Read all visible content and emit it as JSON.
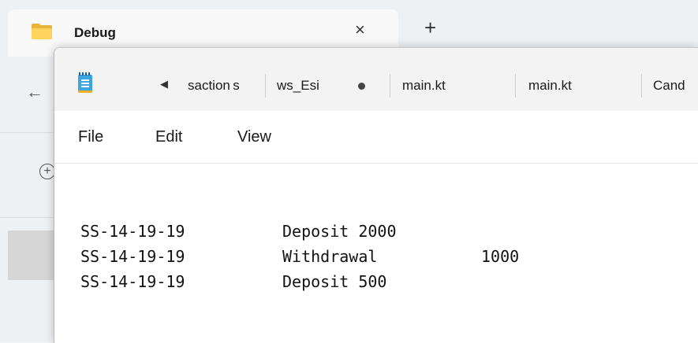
{
  "explorer": {
    "tab_title": "Debug",
    "tab_close": "×",
    "new_tab": "+",
    "nav_back": "←",
    "add": "+"
  },
  "notepad": {
    "scroll_left": "◀",
    "tabs": [
      {
        "label": "saction s"
      },
      {
        "label": "ws_Esi"
      },
      {
        "label": "main.kt"
      },
      {
        "label": "main.kt"
      },
      {
        "label": "Cand"
      }
    ],
    "menu": [
      "File",
      "Edit",
      "View"
    ],
    "lines": [
      {
        "account": "SS-14-19-19",
        "action": "Deposit 2000",
        "amount": ""
      },
      {
        "account": "SS-14-19-19",
        "action": "Withdrawal",
        "amount": "1000"
      },
      {
        "account": "SS-14-19-19",
        "action": "Deposit 500",
        "amount": ""
      }
    ]
  },
  "colors": {
    "notepad_icon": "#3aa5e0",
    "folder": "#ffd45c"
  }
}
